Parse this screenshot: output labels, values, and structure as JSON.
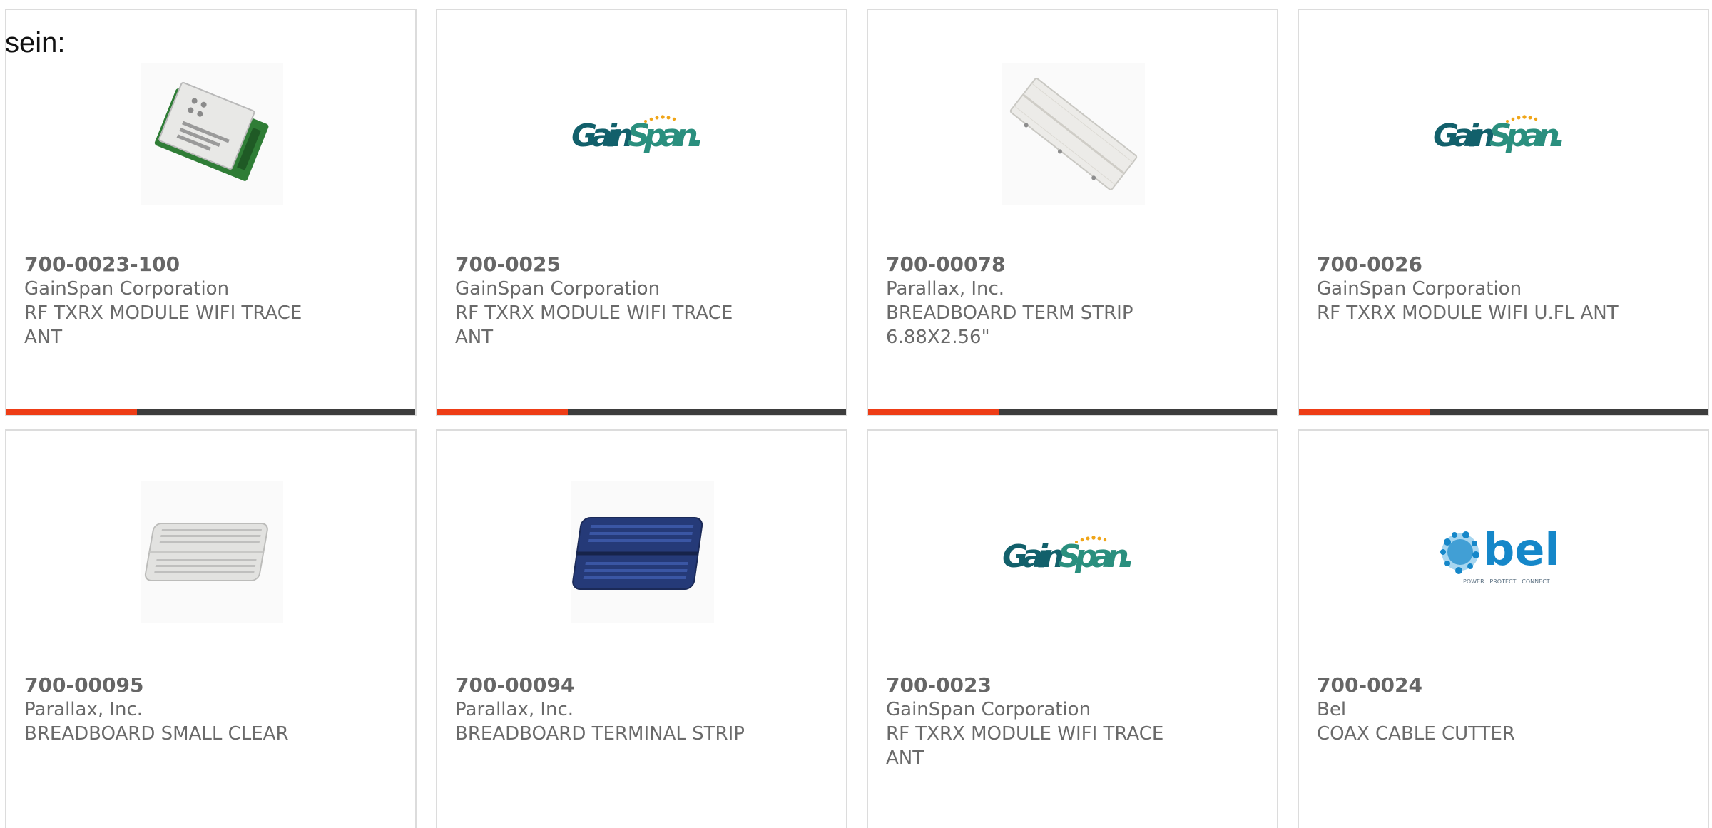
{
  "prefix_text": "sein:",
  "products": [
    {
      "part": "700-0023-100",
      "maker": "GainSpan Corporation",
      "desc": "RF TXRX MODULE WIFI TRACE ANT",
      "image": "wifi-module-image"
    },
    {
      "part": "700-0025",
      "maker": "GainSpan Corporation",
      "desc": "RF TXRX MODULE WIFI TRACE ANT",
      "image": "gainspan-logo"
    },
    {
      "part": "700-00078",
      "maker": "Parallax, Inc.",
      "desc": "BREADBOARD TERM STRIP 6.88X2.56\"",
      "image": "breadboard-strip-image"
    },
    {
      "part": "700-0026",
      "maker": "GainSpan Corporation",
      "desc": "RF TXRX MODULE WIFI U.FL ANT",
      "image": "gainspan-logo"
    },
    {
      "part": "700-00095",
      "maker": "Parallax, Inc.",
      "desc": "BREADBOARD SMALL CLEAR",
      "image": "breadboard-clear-image"
    },
    {
      "part": "700-00094",
      "maker": "Parallax, Inc.",
      "desc": "BREADBOARD TERMINAL STRIP",
      "image": "breadboard-blue-image"
    },
    {
      "part": "700-0023",
      "maker": "GainSpan Corporation",
      "desc": "RF TXRX MODULE WIFI TRACE ANT",
      "image": "gainspan-logo"
    },
    {
      "part": "700-0024",
      "maker": "Bel",
      "desc": "COAX CABLE CUTTER",
      "image": "bel-logo"
    }
  ],
  "logos": {
    "gainspan": {
      "gain": "Gain",
      "span": "Span",
      "dot": "."
    },
    "bel": {
      "text": "bel",
      "tagline": "POWER | PROTECT | CONNECT"
    }
  },
  "colors": {
    "accent": "#ee3d16",
    "bar": "#3d3d3d",
    "text": "#6a6a6a",
    "gainspan_teal": "#12606b",
    "bel_blue": "#1587c9"
  }
}
